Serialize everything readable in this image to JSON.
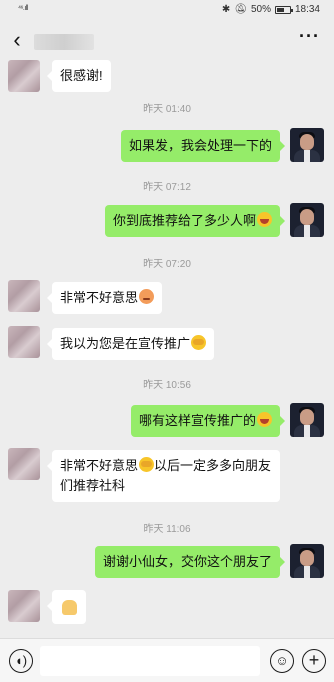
{
  "status_bar": {
    "signal_text": "⁴⁶.ıll",
    "battery_percent": "50%",
    "time": "18:34"
  },
  "nav": {
    "back_icon": "back-arrow-icon",
    "more_label": "···"
  },
  "messages": [
    {
      "type": "text",
      "side": "left",
      "text": "很感谢!"
    },
    {
      "type": "time",
      "text": "昨天 01:40"
    },
    {
      "type": "text",
      "side": "right",
      "text": "如果发，我会处理一下的"
    },
    {
      "type": "time",
      "text": "昨天 07:12"
    },
    {
      "type": "text",
      "side": "right",
      "text": "你到底推荐给了多少人啊",
      "emoji": "laughing-emoji"
    },
    {
      "type": "time",
      "text": "昨天 07:20"
    },
    {
      "type": "text",
      "side": "left",
      "text": "非常不好意思",
      "emoji": "blush-emoji"
    },
    {
      "type": "text",
      "side": "left",
      "text": "我以为您是在宣传推广",
      "emoji": "facepalm-emoji"
    },
    {
      "type": "time",
      "text": "昨天 10:56"
    },
    {
      "type": "text",
      "side": "right",
      "text": "哪有这样宣传推广的",
      "emoji": "laughing-emoji"
    },
    {
      "type": "text",
      "side": "left",
      "text_a": "非常不好意思",
      "text_b": "以后一定多多向朋友们推荐社科",
      "emoji": "facepalm-emoji"
    },
    {
      "type": "time",
      "text": "昨天 11:06"
    },
    {
      "type": "text",
      "side": "right",
      "text": "谢谢小仙女，交你这个朋友了"
    },
    {
      "type": "emoji",
      "side": "left",
      "emoji": "waving-hand-emoji"
    }
  ],
  "input_bar": {
    "voice_icon": "voice-icon",
    "emoji_icon": "emoji-icon",
    "plus_icon": "plus-icon",
    "placeholder": ""
  },
  "colors": {
    "background": "#ededed",
    "bubble_out": "#95ec69",
    "bubble_in": "#ffffff",
    "time_text": "#9a9a9a"
  }
}
